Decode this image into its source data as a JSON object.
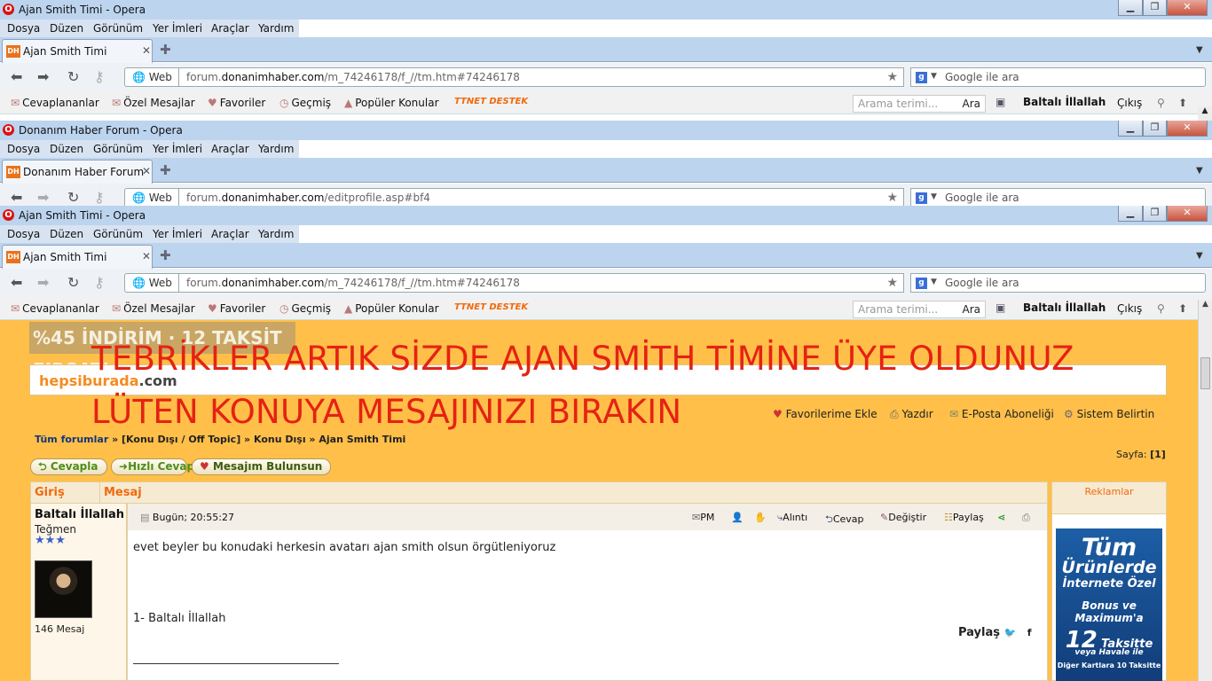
{
  "window1": {
    "title": "Ajan Smith Timi - Opera",
    "tab": "Ajan Smith Timi",
    "url_prefix": "forum.",
    "url_domain": "donanimhaber.com",
    "url_path": "/m_74246178/f_//tm.htm#74246178"
  },
  "window2": {
    "title": "Donanım Haber Forum - Opera",
    "tab": "Donanım Haber Forum",
    "url_prefix": "forum.",
    "url_domain": "donanimhaber.com",
    "url_path": "/editprofile.asp#bf4"
  },
  "window3": {
    "title": "Ajan Smith Timi - Opera",
    "tab": "Ajan Smith Timi",
    "url_prefix": "forum.",
    "url_domain": "donanimhaber.com",
    "url_path": "/m_74246178/f_//tm.htm#74246178"
  },
  "menu": [
    "Dosya",
    "Düzen",
    "Görünüm",
    "Yer İmleri",
    "Araçlar",
    "Yardım"
  ],
  "browser": {
    "web_label": "Web",
    "search_placeholder": "Google ile ara",
    "favicon": "DH",
    "controls": [
      "▁",
      "❐",
      "✕"
    ]
  },
  "bookmarks": {
    "items": [
      "Cevaplananlar",
      "Özel Mesajlar",
      "Favoriler",
      "Geçmiş",
      "Popüler Konular"
    ],
    "brand": "TTNET DESTEK",
    "search_placeholder": "Arama terimi...",
    "search_button": "Ara",
    "user": "Baltalı İllallah",
    "exit": "Çıkış"
  },
  "page": {
    "banner": "%45 İNDİRİM · 12 TAKSİT FIRSATI",
    "ad_site": "hepsiburada",
    "ad_tld": ".com",
    "headline1": "TEBRİKLER ARTIK SİZDE AJAN SMİTH TİMİNE ÜYE OLDUNUZ",
    "headline2": "LÜTEN KONUYA MESAJINIZI BIRAKIN",
    "toplinks": [
      "Favorilerime Ekle",
      "Yazdır",
      "E-Posta Aboneliği",
      "Sistem Belirtin"
    ],
    "breadcrumb": {
      "root": "Tüm forumlar",
      "sep": " » ",
      "c1": "[Konu Dışı / Off Topic]",
      "c2": "Konu Dışı",
      "c3": "Ajan Smith Timi"
    },
    "page_label": "Sayfa:",
    "page_value": "[1]",
    "buttons": [
      "Cevapla",
      "Hızlı Cevap",
      "Mesajım Bulunsun"
    ],
    "col_login": "Giriş",
    "col_message": "Mesaj",
    "ads_label": "Reklamlar"
  },
  "post": {
    "username": "Baltalı İllallah",
    "rank": "Teğmen",
    "stars": "★★★",
    "message_count": "146 Mesaj",
    "time": "Bugün; 20:55:27",
    "tools": [
      "PM",
      "Alıntı",
      "Cevap",
      "Değiştir",
      "Paylaş"
    ],
    "body": "evet beyler bu konudaki herkesin avatarı ajan smith olsun örgütleniyoruz",
    "list_item": "1- Baltalı İllallah",
    "share_label": "Paylaş"
  },
  "ad": {
    "line1": "Tüm",
    "line2": "Ürünlerde",
    "line3": "İnternete Özel",
    "line4": "Bonus ve",
    "line5": "Maximum'a",
    "num": "12",
    "line6": "Taksitte",
    "line7": "veya Havale ile",
    "line8": "Diğer Kartlara 10 Taksitte"
  }
}
